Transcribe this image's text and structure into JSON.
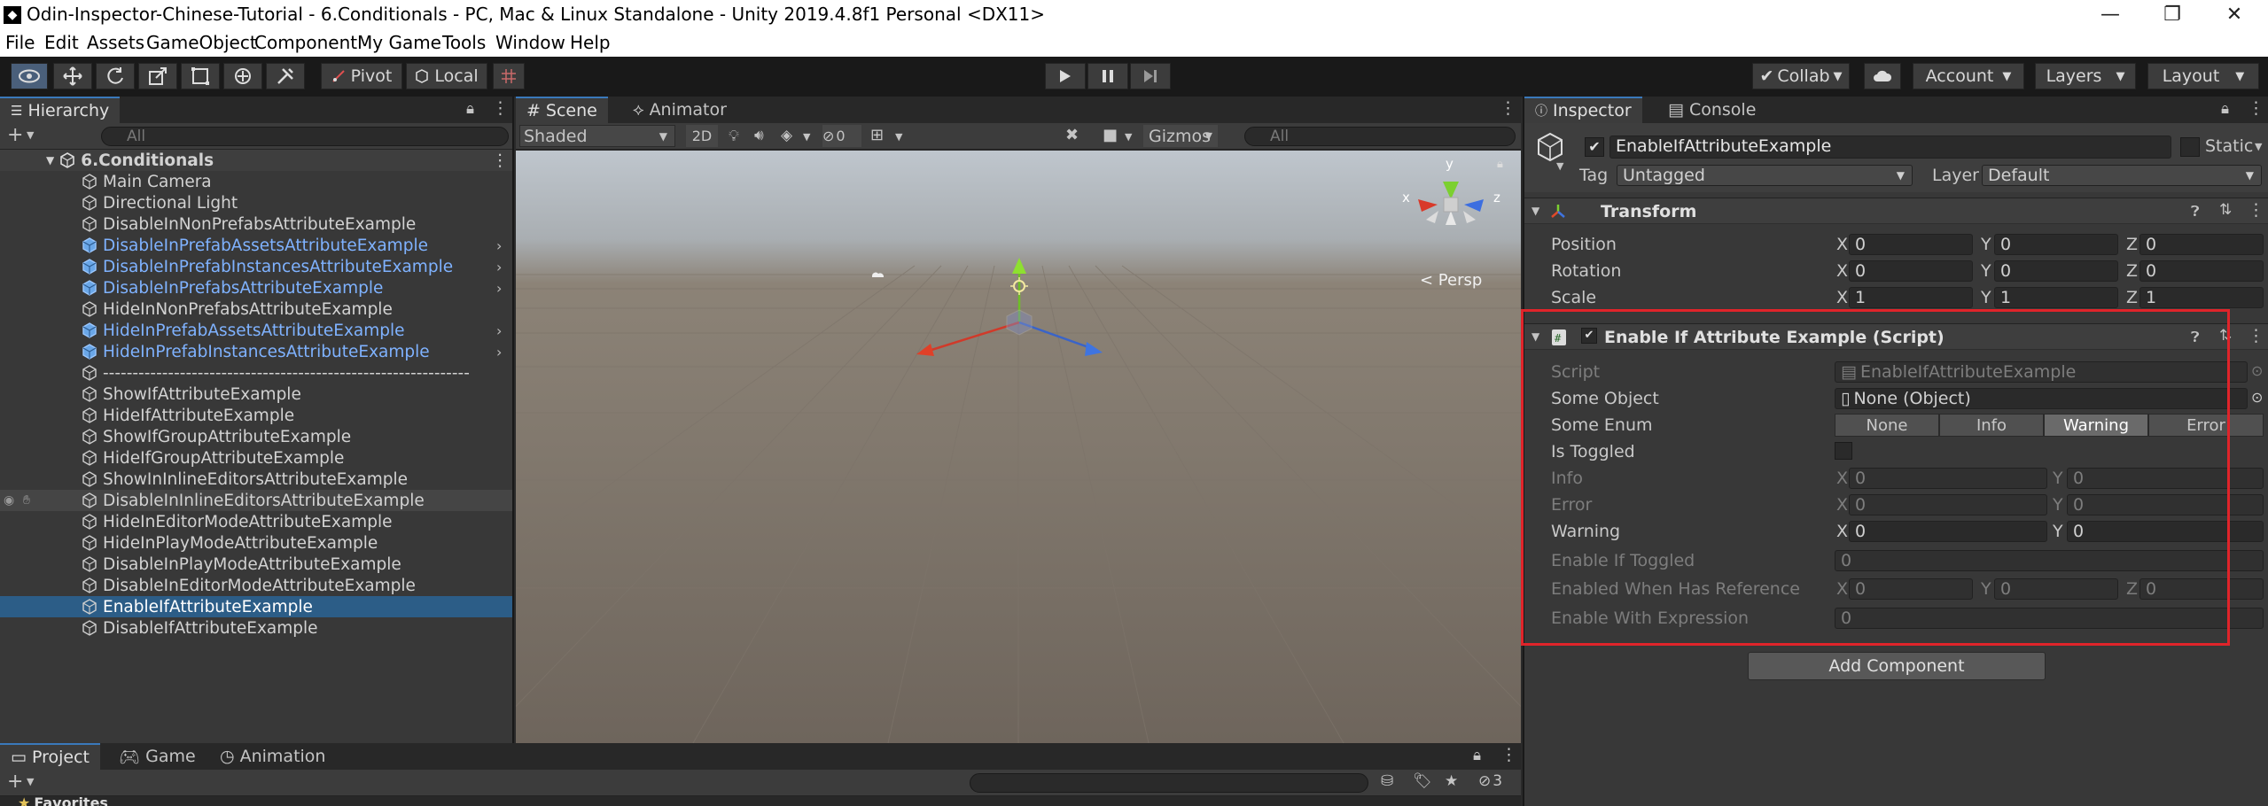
{
  "window": {
    "app_icon": "unity-icon",
    "title": "Odin-Inspector-Chinese-Tutorial - 6.Conditionals - PC, Mac & Linux Standalone - Unity 2019.4.8f1 Personal <DX11>",
    "minimize": "—",
    "maximize": "❐",
    "close": "✕"
  },
  "menu": [
    "File",
    "Edit",
    "Assets",
    "GameObject",
    "Component",
    "My Game",
    "Tools",
    "Window",
    "Help"
  ],
  "toolbar": {
    "pivot_label": "Pivot",
    "local_label": "Local",
    "collab_label": "Collab",
    "account_label": "Account",
    "layers_label": "Layers",
    "layout_label": "Layout"
  },
  "hierarchy": {
    "tab_label": "Hierarchy",
    "search_placeholder": "All",
    "scene_name": "6.Conditionals",
    "items": [
      {
        "name": "Main Camera",
        "style": "normal"
      },
      {
        "name": "Directional Light",
        "style": "normal"
      },
      {
        "name": "DisableInNonPrefabsAttributeExample",
        "style": "normal"
      },
      {
        "name": "DisableInPrefabAssetsAttributeExample",
        "style": "prefab"
      },
      {
        "name": "DisableInPrefabInstancesAttributeExample",
        "style": "prefab"
      },
      {
        "name": "DisableInPrefabsAttributeExample",
        "style": "prefab"
      },
      {
        "name": "HideInNonPrefabsAttributeExample",
        "style": "normal"
      },
      {
        "name": "HideInPrefabAssetsAttributeExample",
        "style": "prefab"
      },
      {
        "name": "HideInPrefabInstancesAttributeExample",
        "style": "prefab"
      },
      {
        "name": "--------------------------------------------------------------",
        "style": "normal"
      },
      {
        "name": "ShowIfAttributeExample",
        "style": "normal"
      },
      {
        "name": "HideIfAttributeExample",
        "style": "normal"
      },
      {
        "name": "ShowIfGroupAttributeExample",
        "style": "normal"
      },
      {
        "name": "HideIfGroupAttributeExample",
        "style": "normal"
      },
      {
        "name": "ShowInInlineEditorsAttributeExample",
        "style": "normal"
      },
      {
        "name": "DisableInInlineEditorsAttributeExample",
        "style": "hover"
      },
      {
        "name": "HideInEditorModeAttributeExample",
        "style": "normal"
      },
      {
        "name": "HideInPlayModeAttributeExample",
        "style": "normal"
      },
      {
        "name": "DisableInPlayModeAttributeExample",
        "style": "normal"
      },
      {
        "name": "DisableInEditorModeAttributeExample",
        "style": "normal"
      },
      {
        "name": "EnableIfAttributeExample",
        "style": "selected"
      },
      {
        "name": "DisableIfAttributeExample",
        "style": "normal"
      }
    ]
  },
  "scene": {
    "tabs": [
      "Scene",
      "Animator"
    ],
    "shading_mode": "Shaded",
    "mode_2d": "2D",
    "hidden_count": "0",
    "gizmos_label": "Gizmos",
    "search_placeholder": "All",
    "persp_label": "< Persp",
    "axis_x": "x",
    "axis_y": "y",
    "axis_z": "z"
  },
  "inspector": {
    "tabs": [
      "Inspector",
      "Console"
    ],
    "object_name": "EnableIfAttributeExample",
    "static_label": "Static",
    "tag_label": "Tag",
    "tag_value": "Untagged",
    "layer_label": "Layer",
    "layer_value": "Default",
    "transform": {
      "title": "Transform",
      "position_label": "Position",
      "rotation_label": "Rotation",
      "scale_label": "Scale",
      "position": [
        "0",
        "0",
        "0"
      ],
      "rotation": [
        "0",
        "0",
        "0"
      ],
      "scale": [
        "1",
        "1",
        "1"
      ]
    },
    "script_component": {
      "title": "Enable If Attribute Example (Script)",
      "script_label": "Script",
      "script_value": "EnableIfAttributeExample",
      "some_object_label": "Some Object",
      "some_object_value": "None (Object)",
      "some_enum_label": "Some Enum",
      "enum_options": [
        "None",
        "Info",
        "Warning",
        "Error"
      ],
      "enum_selected": "Warning",
      "is_toggled_label": "Is Toggled",
      "info_label": "Info",
      "info_values": [
        "0",
        "0"
      ],
      "error_label": "Error",
      "error_values": [
        "0",
        "0"
      ],
      "warning_label": "Warning",
      "warning_values": [
        "0",
        "0"
      ],
      "enable_if_toggled_label": "Enable If Toggled",
      "enable_if_toggled_value": "0",
      "enabled_when_label": "Enabled When Has Reference",
      "enabled_when_values": [
        "0",
        "0",
        "0"
      ],
      "enable_with_expression_label": "Enable With Expression",
      "enable_with_expression_value": "0"
    },
    "add_component_label": "Add Component",
    "highlight_color": "#e0242a"
  },
  "bottom": {
    "tabs": [
      "Project",
      "Game",
      "Animation"
    ],
    "favorites_label": "Favorites",
    "hidden_count": "3"
  }
}
